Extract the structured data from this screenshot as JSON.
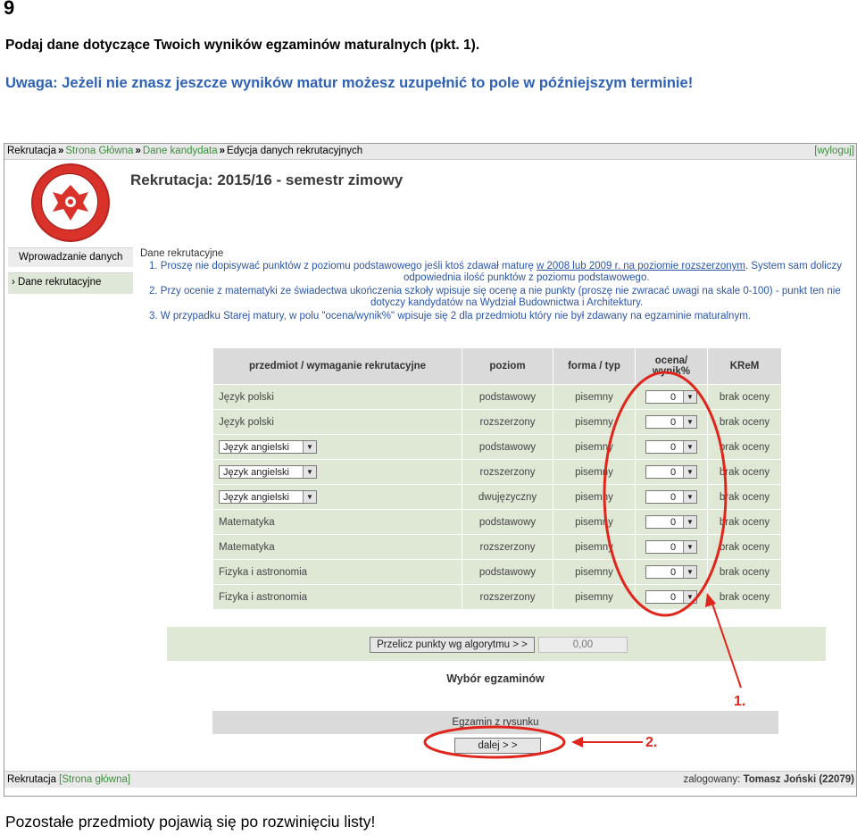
{
  "document": {
    "page_number": "9",
    "intro": "Podaj dane dotyczące Twoich wyników egzaminów maturalnych (pkt. 1).",
    "warning": "Uwaga: Jeżeli nie znasz jeszcze wyników matur możesz uzupełnić to pole w późniejszym terminie!",
    "bottom_note": "Pozostałe przedmioty pojawią się po rozwinięciu listy!"
  },
  "topbar": {
    "crumb_root": "Rekrutacja",
    "crumb_home": "Strona Główna",
    "crumb_candidate": "Dane kandydata",
    "crumb_current": "Edycja danych rekrutacyjnych",
    "logout": "[wyloguj]"
  },
  "header": {
    "title": "Rekrutacja: 2015/16 - semestr zimowy"
  },
  "sidebar": {
    "heading": "Wprowadzanie danych",
    "item": "Dane rekrutacyjne"
  },
  "section": {
    "title": "Dane rekrutacyjne",
    "instr1_a": "1. Proszę nie dopisywać punktów z poziomu podstawowego jeśli ktoś zdawał maturę ",
    "instr1_u": "w 2008 lub 2009 r. na poziomie rozszerzonym",
    "instr1_b": ". System sam doliczy",
    "instr1_c": "odpowiednia ilość punktów z poziomu podstawowego.",
    "instr2_a": "2. Przy ocenie z matematyki ze świadectwa ukończenia szkoły wpisuje się ocenę a nie punkty (proszę nie zwracać uwagi na skale 0-100)  - punkt ten nie",
    "instr2_b": "dotyczy kandydatów na Wydział Budownictwa i Architektury.",
    "instr3": "3. W przypadku Starej matury, w polu \"ocena/wynik%\" wpisuje się 2 dla przedmiotu który nie był zdawany na egzaminie maturalnym."
  },
  "table": {
    "headers": [
      "przedmiot / wymaganie rekrutacyjne",
      "poziom",
      "forma / typ",
      "ocena/ wynik%",
      "KReM"
    ],
    "rows": [
      {
        "subject": "Język polski",
        "select": false,
        "level": "podstawowy",
        "form": "pisemny",
        "grade": "0",
        "krem": "brak oceny"
      },
      {
        "subject": "Język polski",
        "select": false,
        "level": "rozszerzony",
        "form": "pisemny",
        "grade": "0",
        "krem": "brak oceny"
      },
      {
        "subject": "Język angielski",
        "select": true,
        "level": "podstawowy",
        "form": "pisemny",
        "grade": "0",
        "krem": "brak oceny"
      },
      {
        "subject": "Język angielski",
        "select": true,
        "level": "rozszerzony",
        "form": "pisemny",
        "grade": "0",
        "krem": "brak oceny"
      },
      {
        "subject": "Język angielski",
        "select": true,
        "level": "dwujęzyczny",
        "form": "pisemny",
        "grade": "0",
        "krem": "brak oceny"
      },
      {
        "subject": "Matematyka",
        "select": false,
        "level": "podstawowy",
        "form": "pisemny",
        "grade": "0",
        "krem": "brak oceny"
      },
      {
        "subject": "Matematyka",
        "select": false,
        "level": "rozszerzony",
        "form": "pisemny",
        "grade": "0",
        "krem": "brak oceny"
      },
      {
        "subject": "Fizyka i astronomia",
        "select": false,
        "level": "podstawowy",
        "form": "pisemny",
        "grade": "0",
        "krem": "brak oceny"
      },
      {
        "subject": "Fizyka i astronomia",
        "select": false,
        "level": "rozszerzony",
        "form": "pisemny",
        "grade": "0",
        "krem": "brak oceny"
      }
    ]
  },
  "calc": {
    "button": "Przelicz punkty wg algorytmu > >",
    "points": "0,00"
  },
  "exams": {
    "title": "Wybór egzaminów",
    "band": "Egzamin z rysunku",
    "next_button": "dalej > >"
  },
  "footer": {
    "left_root": "Rekrutacja",
    "left_link": "[Strona główna]",
    "user_label": "zalogowany: ",
    "user_name": "Tomasz Joński (22079)"
  },
  "annotations": {
    "label_1": "1.",
    "label_2": "2.",
    "color": "#e0261c"
  }
}
